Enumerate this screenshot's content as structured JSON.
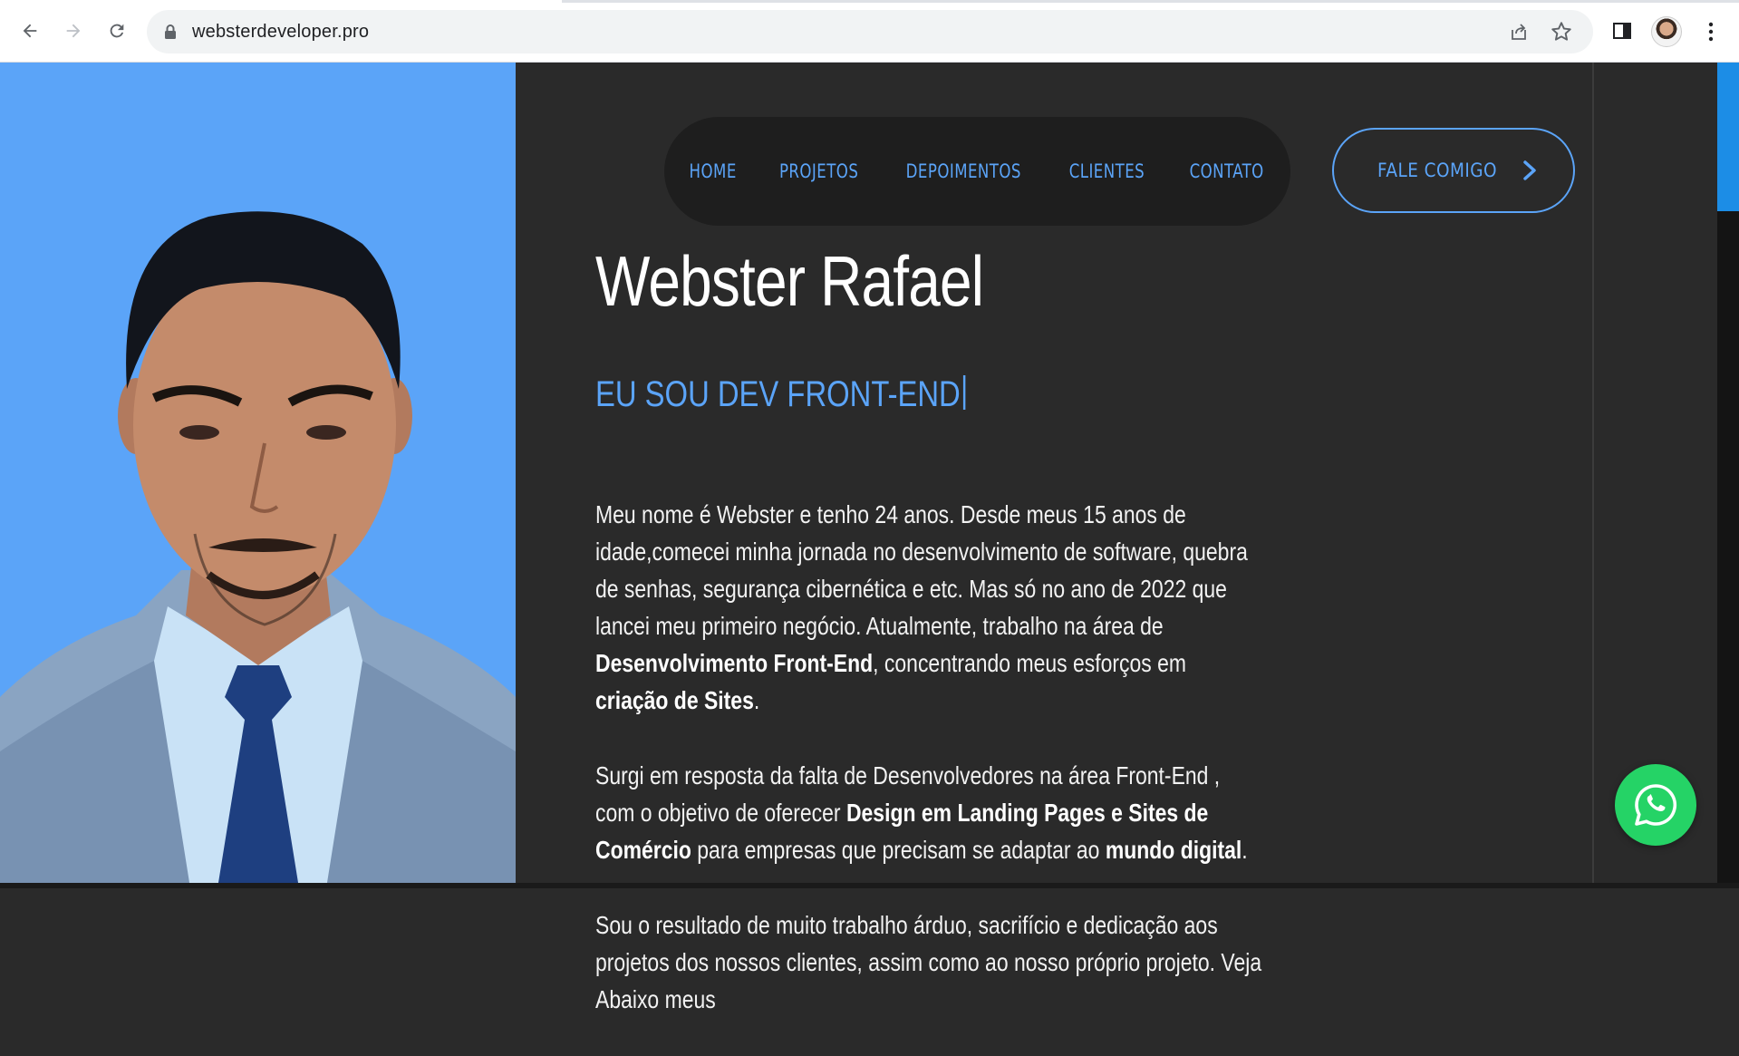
{
  "browser": {
    "url": "websterdeveloper.pro",
    "icons": [
      "back-icon",
      "forward-icon",
      "reload-icon",
      "lock-icon",
      "share-icon",
      "star-icon",
      "side-panel-icon",
      "profile-avatar",
      "more-icon"
    ]
  },
  "nav": {
    "items": [
      {
        "label": "HOME"
      },
      {
        "label": "PROJETOS"
      },
      {
        "label": "DEPOIMENTOS"
      },
      {
        "label": "CLIENTES"
      },
      {
        "label": "CONTATO"
      }
    ],
    "cta_label": "FALE COMIGO"
  },
  "hero": {
    "title": "Webster Rafael",
    "subtitle": "EU SOU DEV FRONT-END"
  },
  "bio": {
    "p1": [
      "Meu nome é Webster e tenho 24 anos. Desde meus 15 anos de idade,comecei minha jornada no desenvolvimento de software, quebra de senhas, segurança cibernética e etc. Mas só no ano de 2022 que lancei meu primeiro negócio. Atualmente, trabalho na área de ",
      "Desenvolvimento Front-End",
      ", concentrando meus esforços em ",
      "criação de Sites",
      "."
    ],
    "p2": [
      "Surgi em resposta da falta de Desenvolvedores na área Front-End , com o objetivo de oferecer ",
      "Design em Landing Pages e Sites de Comércio",
      " para empresas que precisam se adaptar ao ",
      "mundo digital",
      "."
    ],
    "p3": [
      "Sou o resultado de muito trabalho árduo, sacrifício e dedicação aos projetos dos nossos clientes, assim como ao nosso próprio projeto. Veja Abaixo meus"
    ]
  },
  "colors": {
    "accent": "#5ba4f8",
    "background": "#2a2a2a",
    "navbar": "#1e1e1e",
    "whatsapp": "#25d366"
  },
  "floating": {
    "icon": "whatsapp-icon"
  }
}
